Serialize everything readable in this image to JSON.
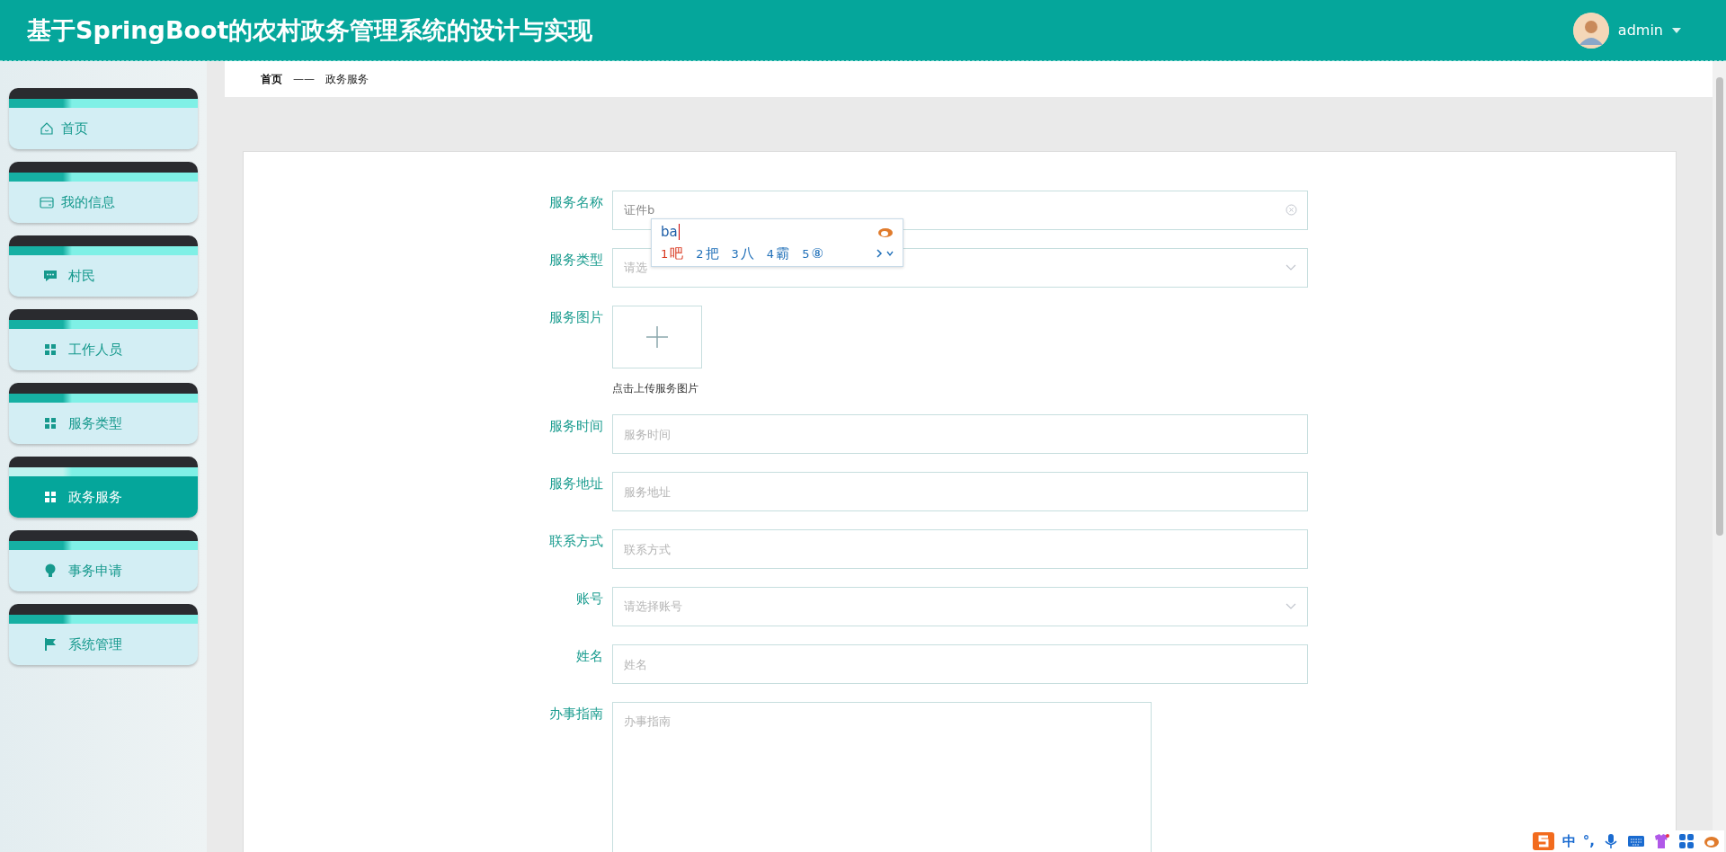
{
  "header": {
    "title": "基于SpringBoot的农村政务管理系统的设计与实现",
    "user": "admin"
  },
  "sidebar": {
    "items": [
      {
        "label": "首页",
        "selected": false
      },
      {
        "label": "我的信息",
        "selected": false
      },
      {
        "label": "村民",
        "selected": false
      },
      {
        "label": "工作人员",
        "selected": false
      },
      {
        "label": "服务类型",
        "selected": false
      },
      {
        "label": "政务服务",
        "selected": true
      },
      {
        "label": "事务申请",
        "selected": false
      },
      {
        "label": "系统管理",
        "selected": false
      }
    ]
  },
  "breadcrumb": {
    "items": [
      "首页",
      "政务服务"
    ],
    "separator": "——"
  },
  "form": {
    "fields": [
      {
        "kind": "text",
        "label": "服务名称",
        "value": "证件b",
        "clearable": true
      },
      {
        "kind": "select",
        "label": "服务类型",
        "placeholder": "请选"
      },
      {
        "kind": "upload",
        "label": "服务图片",
        "hint": "点击上传服务图片"
      },
      {
        "kind": "text",
        "label": "服务时间",
        "placeholder": "服务时间"
      },
      {
        "kind": "text",
        "label": "服务地址",
        "placeholder": "服务地址"
      },
      {
        "kind": "text",
        "label": "联系方式",
        "placeholder": "联系方式"
      },
      {
        "kind": "select",
        "label": "账号",
        "placeholder": "请选择账号"
      },
      {
        "kind": "text",
        "label": "姓名",
        "placeholder": "姓名"
      },
      {
        "kind": "textarea",
        "label": "办事指南",
        "placeholder": "办事指南"
      }
    ]
  },
  "ime_popup": {
    "input": "ba",
    "candidates": [
      {
        "number": "1",
        "text": "吧",
        "selected": true
      },
      {
        "number": "2",
        "text": "把",
        "selected": false
      },
      {
        "number": "3",
        "text": "八",
        "selected": false
      },
      {
        "number": "4",
        "text": "霸",
        "selected": false
      },
      {
        "number": "5",
        "text": "⑧",
        "selected": false
      }
    ]
  },
  "ime_toolbar": {
    "mode": "中",
    "punctuation": "°,"
  }
}
